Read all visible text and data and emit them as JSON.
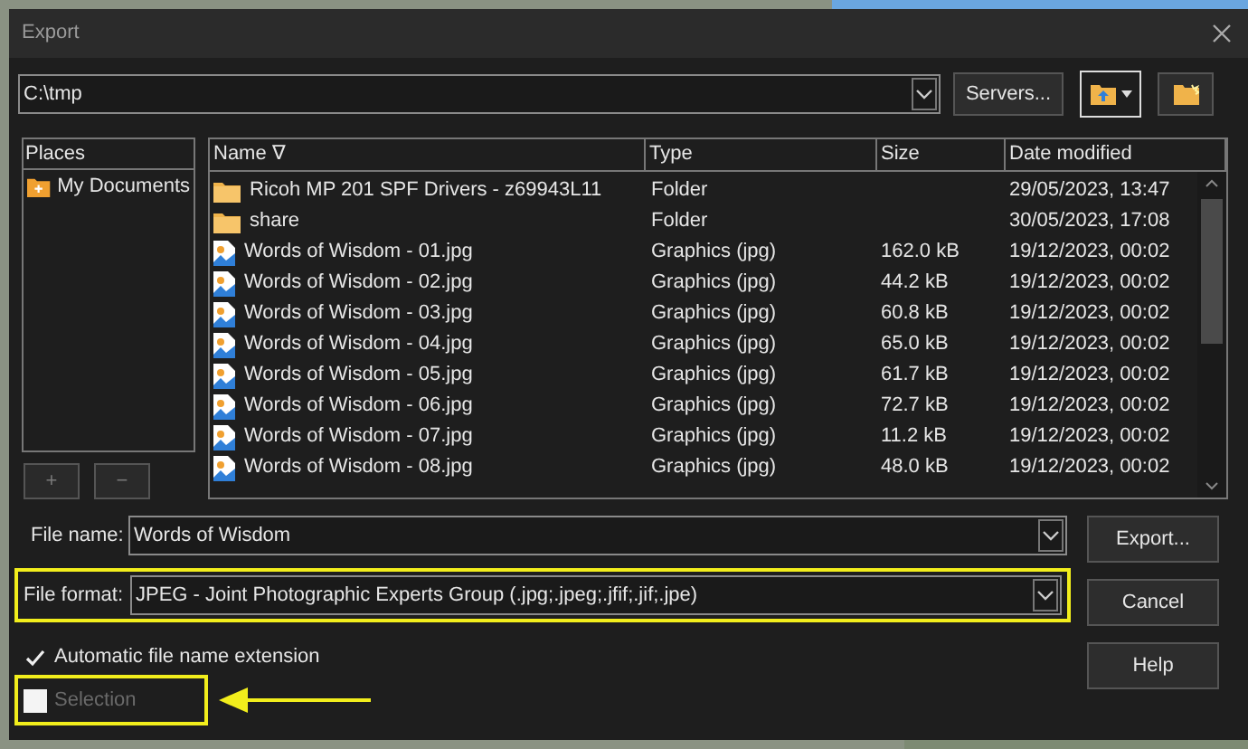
{
  "window": {
    "title": "Export"
  },
  "path_bar": {
    "value": "C:\\tmp",
    "servers_button": "Servers..."
  },
  "places": {
    "header": "Places",
    "items": [
      {
        "label": "My Documents"
      }
    ],
    "buttons": [
      {
        "label": "+",
        "disabled": true
      },
      {
        "label": "−",
        "disabled": true
      }
    ]
  },
  "file_list": {
    "columns": [
      "Name ∇",
      "Type",
      "Size",
      "Date modified"
    ],
    "rows": [
      {
        "kind": "folder",
        "name": "Ricoh MP 201 SPF Drivers - z69943L11",
        "type": "Folder",
        "size": "",
        "date": "29/05/2023, 13:47"
      },
      {
        "kind": "folder",
        "name": "share",
        "type": "Folder",
        "size": "",
        "date": "30/05/2023, 17:08"
      },
      {
        "kind": "image",
        "name": "Words of Wisdom - 01.jpg",
        "type": "Graphics (jpg)",
        "size": "162.0 kB",
        "date": "19/12/2023, 00:02"
      },
      {
        "kind": "image",
        "name": "Words of Wisdom - 02.jpg",
        "type": "Graphics (jpg)",
        "size": "44.2 kB",
        "date": "19/12/2023, 00:02"
      },
      {
        "kind": "image",
        "name": "Words of Wisdom - 03.jpg",
        "type": "Graphics (jpg)",
        "size": "60.8 kB",
        "date": "19/12/2023, 00:02"
      },
      {
        "kind": "image",
        "name": "Words of Wisdom - 04.jpg",
        "type": "Graphics (jpg)",
        "size": "65.0 kB",
        "date": "19/12/2023, 00:02"
      },
      {
        "kind": "image",
        "name": "Words of Wisdom - 05.jpg",
        "type": "Graphics (jpg)",
        "size": "61.7 kB",
        "date": "19/12/2023, 00:02"
      },
      {
        "kind": "image",
        "name": "Words of Wisdom - 06.jpg",
        "type": "Graphics (jpg)",
        "size": "72.7 kB",
        "date": "19/12/2023, 00:02"
      },
      {
        "kind": "image",
        "name": "Words of Wisdom - 07.jpg",
        "type": "Graphics (jpg)",
        "size": "11.2 kB",
        "date": "19/12/2023, 00:02"
      },
      {
        "kind": "image",
        "name": "Words of Wisdom - 08.jpg",
        "type": "Graphics (jpg)",
        "size": "48.0 kB",
        "date": "19/12/2023, 00:02"
      }
    ]
  },
  "file_name": {
    "label": "File name:",
    "value": "Words of Wisdom"
  },
  "file_format": {
    "label": "File format:",
    "value": "JPEG - Joint Photographic Experts Group (.jpg;.jpeg;.jfif;.jif;.jpe)",
    "highlighted": true
  },
  "options": [
    {
      "label": "Automatic file name extension",
      "checked": true,
      "disabled": false,
      "highlighted": false
    },
    {
      "label": "Selection",
      "checked": false,
      "disabled": true,
      "highlighted": true
    }
  ],
  "buttons": [
    "Export...",
    "Cancel",
    "Help"
  ]
}
